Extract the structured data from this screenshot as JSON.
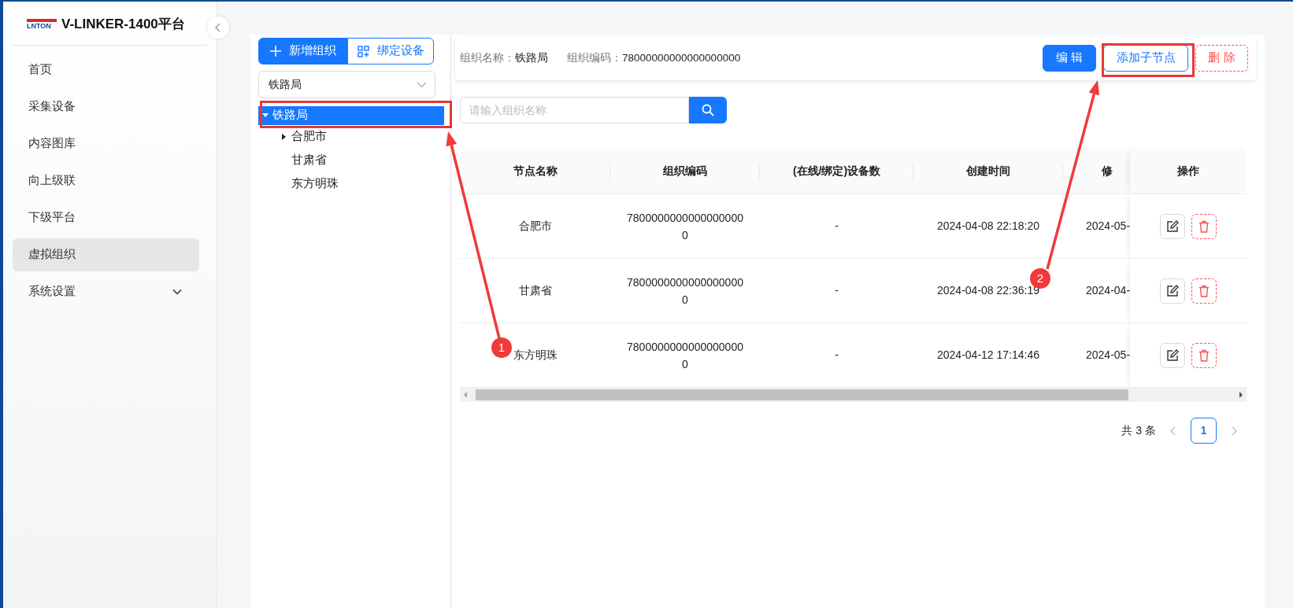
{
  "app": {
    "logo_text": "LNTON",
    "title": "V-LINKER-1400平台"
  },
  "sidebar": {
    "items": [
      {
        "label": "首页",
        "selected": false
      },
      {
        "label": "采集设备",
        "selected": false
      },
      {
        "label": "内容图库",
        "selected": false
      },
      {
        "label": "向上级联",
        "selected": false
      },
      {
        "label": "下级平台",
        "selected": false
      },
      {
        "label": "虚拟组织",
        "selected": true
      },
      {
        "label": "系统设置",
        "selected": false,
        "expanded": false
      }
    ]
  },
  "tree_panel": {
    "buttons": [
      {
        "label": "新增组织",
        "kind": "primary"
      },
      {
        "label": "绑定设备",
        "kind": "outline"
      }
    ],
    "select": {
      "value": "铁路局"
    },
    "tree": [
      {
        "label": "铁路局",
        "selected": true,
        "expanded": true,
        "children": [
          {
            "label": "合肥市",
            "selected": false,
            "expanded": false
          },
          {
            "label": "甘肃省",
            "selected": false
          },
          {
            "label": "东方明珠",
            "selected": false
          }
        ]
      }
    ]
  },
  "detail_header": {
    "fields": [
      {
        "label": "组织名称：",
        "value": "铁路局"
      },
      {
        "label": "组织编码：",
        "value": "78000000000000000000"
      }
    ],
    "buttons": [
      {
        "label": "编 辑",
        "kind": "primary"
      },
      {
        "label": "添加子节点",
        "kind": "outline"
      },
      {
        "label": "删 除",
        "kind": "danger"
      }
    ]
  },
  "search": {
    "placeholder": "请输入组织名称"
  },
  "table": {
    "columns": [
      "节点名称",
      "组织编码",
      "(在线/绑定)设备数",
      "创建时间",
      "修",
      "操作"
    ],
    "rows": [
      {
        "cells": [
          "合肥市",
          "78000000000000000000",
          "-",
          "2024-04-08 22:18:20",
          "2024-05-"
        ]
      },
      {
        "cells": [
          "甘肃省",
          "78000000000000000000",
          "-",
          "2024-04-08 22:36:19",
          "2024-04-"
        ]
      },
      {
        "cells": [
          "东方明珠",
          "78000000000000000000",
          "-",
          "2024-04-12 17:14:46",
          "2024-05-"
        ]
      }
    ]
  },
  "pagination": {
    "total": "共 3 条",
    "pages": [
      {
        "label": "1",
        "selected": true
      }
    ]
  },
  "annotations": {
    "markers": [
      {
        "label": "1"
      },
      {
        "label": "2"
      }
    ]
  }
}
